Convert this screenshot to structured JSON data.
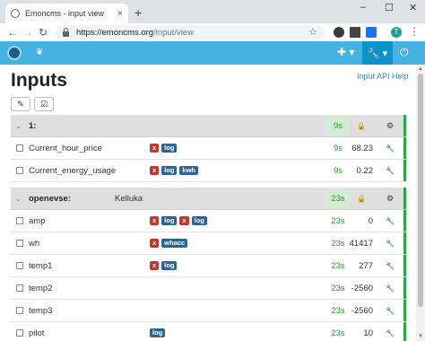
{
  "browser": {
    "tab_title": "Emoncms - input view",
    "url_host": "https://emoncms.org",
    "url_path": "/input/view",
    "new_tab": "+",
    "close": "×",
    "minimize": "–",
    "maximize": "☐",
    "win_close": "✕",
    "avatar_letter": "T"
  },
  "page": {
    "title": "Inputs",
    "api_help": "Input API Help"
  },
  "groups": [
    {
      "name": "1:",
      "desc": "",
      "time": "9s",
      "inputs": [
        {
          "name": "Current_hour_price",
          "process": [
            {
              "type": "x",
              "label": "x"
            },
            {
              "type": "t",
              "label": "log"
            }
          ],
          "time": "9s",
          "value": "68.23"
        },
        {
          "name": "Current_energy_usage",
          "process": [
            {
              "type": "x",
              "label": "x"
            },
            {
              "type": "t",
              "label": "log"
            },
            {
              "type": "t",
              "label": "kwh"
            }
          ],
          "time": "9s",
          "value": "0.22"
        }
      ]
    },
    {
      "name": "openevse:",
      "desc": "Kelluka",
      "time": "23s",
      "inputs": [
        {
          "name": "amp",
          "process": [
            {
              "type": "x",
              "label": "x"
            },
            {
              "type": "t",
              "label": "log"
            },
            {
              "type": "x",
              "label": "x"
            },
            {
              "type": "t",
              "label": "log"
            }
          ],
          "time": "23s",
          "value": "0"
        },
        {
          "name": "wh",
          "process": [
            {
              "type": "x",
              "label": "x"
            },
            {
              "type": "t",
              "label": "whacc"
            }
          ],
          "time": "23s",
          "value": "41417"
        },
        {
          "name": "temp1",
          "process": [
            {
              "type": "x",
              "label": "x"
            },
            {
              "type": "t",
              "label": "log"
            }
          ],
          "time": "23s",
          "value": "277"
        },
        {
          "name": "temp2",
          "process": [],
          "time": "23s",
          "value": "-2560"
        },
        {
          "name": "temp3",
          "process": [],
          "time": "23s",
          "value": "-2560"
        },
        {
          "name": "pilot",
          "process": [
            {
              "type": "t",
              "label": "log"
            }
          ],
          "time": "23s",
          "value": "10"
        }
      ]
    }
  ],
  "colors": {
    "navbar": "#44b3e2",
    "active": "#0e93c9",
    "status_ok": "#28a745",
    "badge_x": "#c0392b",
    "badge_tag": "#2a6496"
  }
}
